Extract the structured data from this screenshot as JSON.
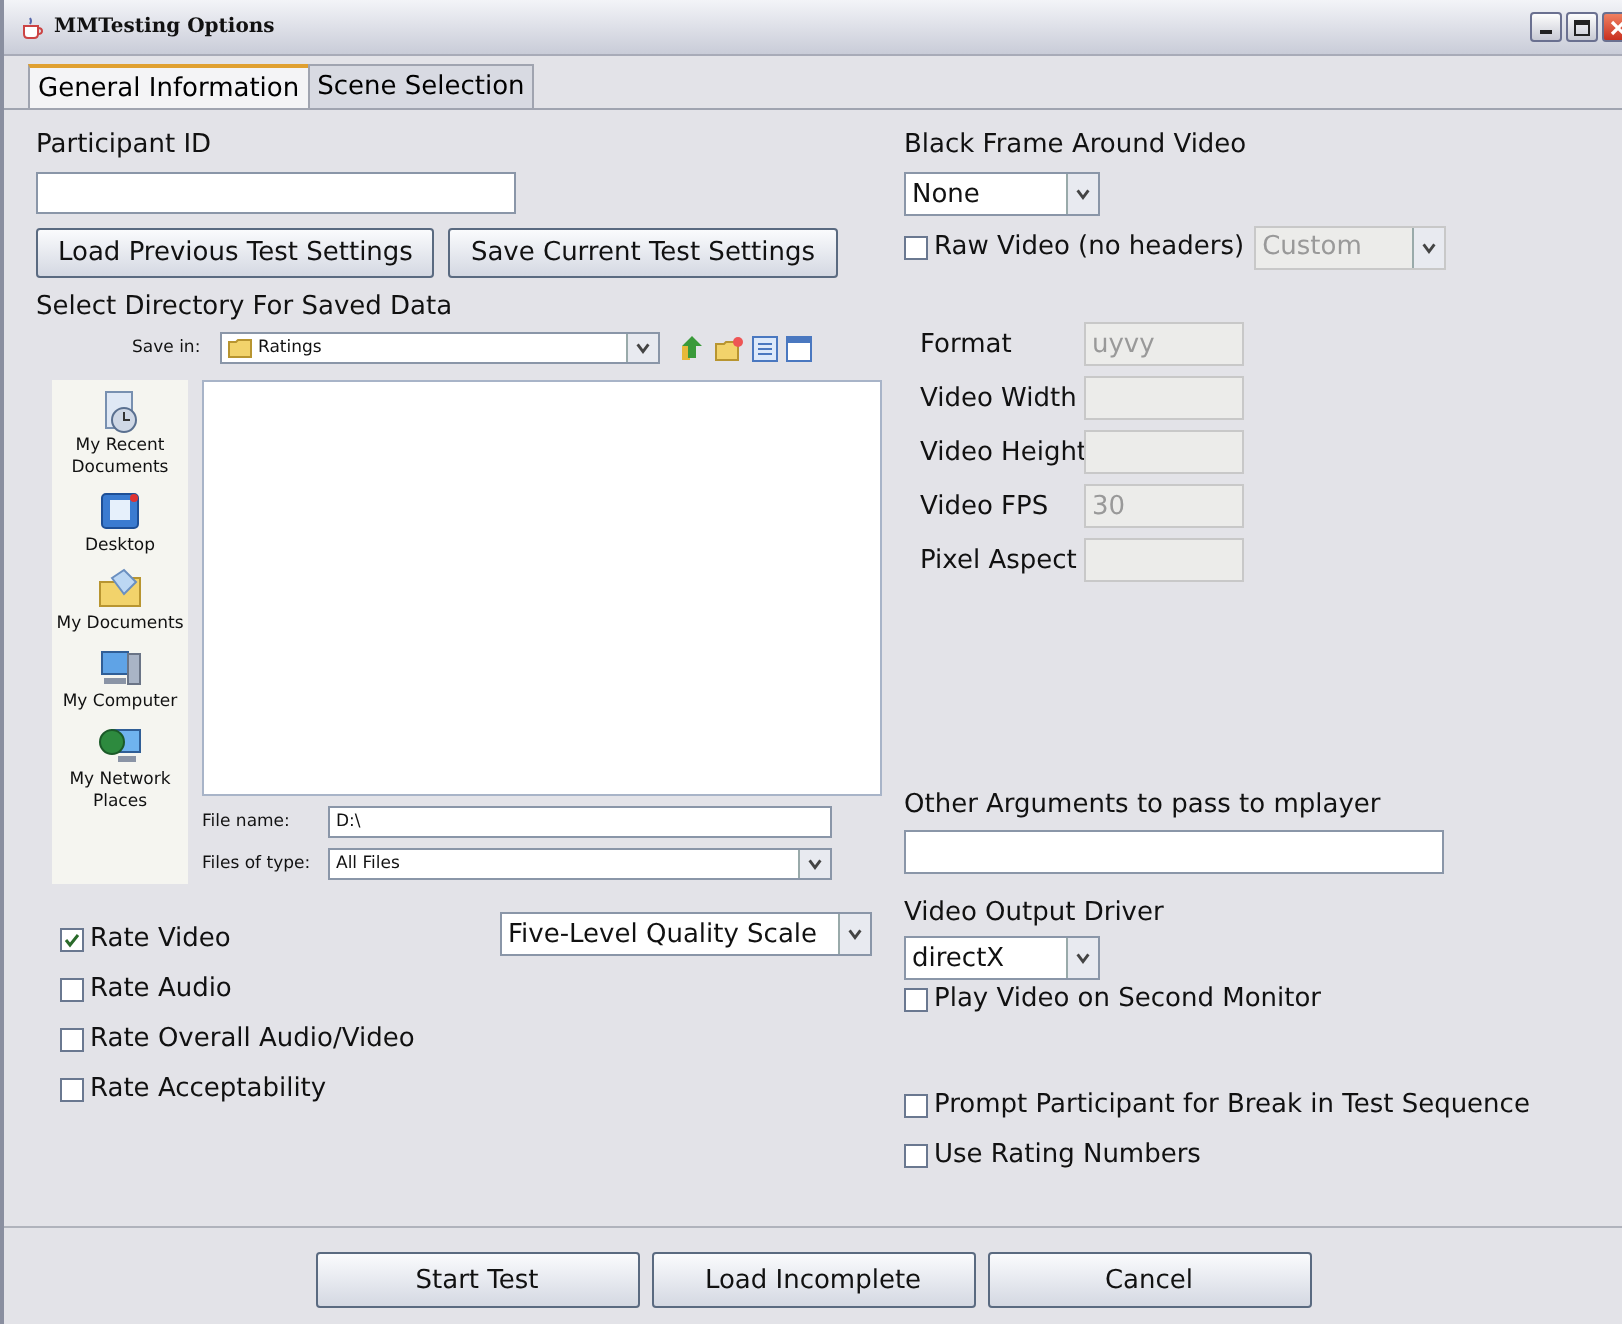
{
  "window": {
    "title": "MMTesting Options"
  },
  "tabs": [
    {
      "label": "General Information",
      "selected": true
    },
    {
      "label": "Scene Selection",
      "selected": false
    }
  ],
  "participant": {
    "label": "Participant ID"
  },
  "settings_buttons": [
    "Load Previous Test Settings",
    "Save Current Test Settings"
  ],
  "save_directory": {
    "label": "Select Directory For Saved Data",
    "save_in_label": "Save in:",
    "save_in_value": "Ratings",
    "places": [
      {
        "label": "My Recent Documents",
        "kind": "recent"
      },
      {
        "label": "Desktop",
        "kind": "desktop"
      },
      {
        "label": "My Documents",
        "kind": "documents"
      },
      {
        "label": "My Computer",
        "kind": "computer"
      },
      {
        "label": "My Network Places",
        "kind": "network"
      }
    ],
    "file_name_label": "File name:",
    "file_name_value": "D:\\",
    "files_of_type_label": "Files of type:",
    "files_of_type_value": "All Files"
  },
  "rating_options": [
    {
      "label": "Rate Video",
      "checked": true
    },
    {
      "label": "Rate Audio",
      "checked": false
    },
    {
      "label": "Rate Overall Audio/Video",
      "checked": false
    },
    {
      "label": "Rate Acceptability",
      "checked": false
    }
  ],
  "scale": {
    "value": "Five-Level Quality Scale"
  },
  "black_frame": {
    "label": "Black Frame Around Video",
    "value": "None"
  },
  "raw_video": {
    "label": "Raw Video (no headers)",
    "checked": false,
    "format_value": "Custom"
  },
  "video_params": [
    {
      "label": "Format",
      "value": "uyvy"
    },
    {
      "label": "Video Width"
    },
    {
      "label": "Video Height"
    },
    {
      "label": "Video FPS",
      "value": "30"
    },
    {
      "label": "Pixel Aspect"
    }
  ],
  "other_args": {
    "label": "Other Arguments to pass to mplayer"
  },
  "output_driver": {
    "label": "Video Output Driver",
    "value": "directX"
  },
  "monitor_option": {
    "label": "Play Video on Second Monitor",
    "checked": false
  },
  "session_options": [
    {
      "label": "Prompt Participant for Break in Test Sequence",
      "checked": false
    },
    {
      "label": "Use Rating Numbers",
      "checked": false
    }
  ],
  "footer_buttons": [
    "Start Test",
    "Load Incomplete",
    "Cancel"
  ]
}
